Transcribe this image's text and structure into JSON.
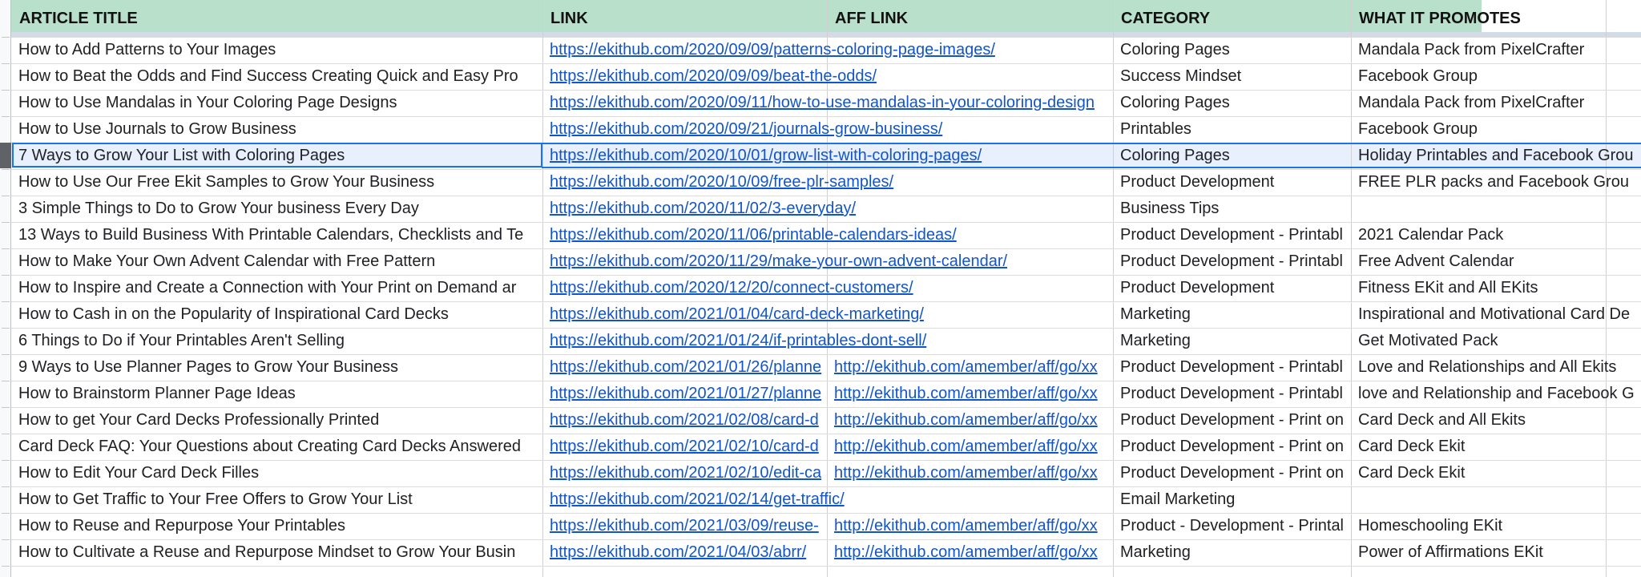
{
  "columns": [
    {
      "key": "title",
      "label": "ARTICLE TITLE"
    },
    {
      "key": "link",
      "label": "LINK"
    },
    {
      "key": "aff",
      "label": "AFF LINK"
    },
    {
      "key": "category",
      "label": "CATEGORY"
    },
    {
      "key": "promotes",
      "label": "WHAT IT PROMOTES"
    }
  ],
  "rows": [
    {
      "title": "How to Add Patterns to Your Images",
      "link": "https://ekithub.com/2020/09/09/patterns-coloring-page-images/",
      "aff": "",
      "category": "Coloring Pages",
      "promotes": "Mandala Pack from PixelCrafter"
    },
    {
      "title": "How to Beat the Odds and Find Success Creating Quick and Easy Pro",
      "link": "https://ekithub.com/2020/09/09/beat-the-odds/",
      "aff": "",
      "category": "Success Mindset",
      "promotes": "Facebook Group"
    },
    {
      "title": "How to Use Mandalas in Your Coloring Page Designs",
      "link": "https://ekithub.com/2020/09/11/how-to-use-mandalas-in-your-coloring-design",
      "aff": "",
      "category": "Coloring Pages",
      "promotes": "Mandala Pack from PixelCrafter"
    },
    {
      "title": "How to Use Journals to Grow Business",
      "link": "https://ekithub.com/2020/09/21/journals-grow-business/",
      "aff": "",
      "category": "Printables",
      "promotes": "Facebook Group"
    },
    {
      "title": "7 Ways to Grow Your List with Coloring Pages",
      "link": "https://ekithub.com/2020/10/01/grow-list-with-coloring-pages/",
      "aff": "",
      "category": "Coloring Pages",
      "promotes": "Holiday Printables and Facebook Grou"
    },
    {
      "title": "How to Use Our Free Ekit Samples to Grow Your Business",
      "link": "https://ekithub.com/2020/10/09/free-plr-samples/",
      "aff": "",
      "category": "Product Development",
      "promotes": "FREE PLR packs and Facebook Grou"
    },
    {
      "title": "3 Simple Things to Do to Grow Your business Every Day",
      "link": "https://ekithub.com/2020/11/02/3-everyday/",
      "aff": "",
      "category": "Business Tips",
      "promotes": ""
    },
    {
      "title": "13 Ways to Build Business With Printable Calendars, Checklists and Te",
      "link": "https://ekithub.com/2020/11/06/printable-calendars-ideas/",
      "aff": "",
      "category": "Product Development - Printabl",
      "promotes": "2021 Calendar Pack"
    },
    {
      "title": "How to Make Your Own Advent Calendar with Free Pattern",
      "link": "https://ekithub.com/2020/11/29/make-your-own-advent-calendar/",
      "aff": "",
      "category": "Product Development - Printabl",
      "promotes": "Free Advent Calendar"
    },
    {
      "title": "How to Inspire and Create a Connection with Your Print on Demand ar",
      "link": "https://ekithub.com/2020/12/20/connect-customers/",
      "aff": "",
      "category": "Product Development",
      "promotes": "Fitness EKit and All EKits"
    },
    {
      "title": "How to Cash in on the Popularity of Inspirational Card Decks",
      "link": "https://ekithub.com/2021/01/04/card-deck-marketing/",
      "aff": "",
      "category": "Marketing",
      "promotes": "Inspirational and Motivational Card De"
    },
    {
      "title": "6 Things to Do if Your Printables Aren't Selling",
      "link": "https://ekithub.com/2021/01/24/if-printables-dont-sell/",
      "aff": "",
      "category": "Marketing",
      "promotes": "Get Motivated Pack"
    },
    {
      "title": "9 Ways to Use Planner Pages to Grow Your Business",
      "link": "https://ekithub.com/2021/01/26/planne",
      "aff": "http://ekithub.com/amember/aff/go/xx",
      "category": "Product Development - Printabl",
      "promotes": "Love and Relationships and All Ekits"
    },
    {
      "title": "How to Brainstorm Planner Page Ideas",
      "link": "https://ekithub.com/2021/01/27/planne",
      "aff": "http://ekithub.com/amember/aff/go/xx",
      "category": "Product Development - Printabl",
      "promotes": "love and Relationship and Facebook G"
    },
    {
      "title": "How to get Your Card Decks Professionally Printed",
      "link": "https://ekithub.com/2021/02/08/card-d",
      "aff": "http://ekithub.com/amember/aff/go/xx",
      "category": "Product Development - Print on",
      "promotes": "Card Deck and All Ekits"
    },
    {
      "title": "Card Deck FAQ: Your Questions about Creating Card Decks Answered",
      "link": "https://ekithub.com/2021/02/10/card-d",
      "aff": "http://ekithub.com/amember/aff/go/xx",
      "category": "Product Development - Print on",
      "promotes": "Card Deck Ekit"
    },
    {
      "title": "How to Edit Your Card Deck Filles",
      "link": "https://ekithub.com/2021/02/10/edit-ca",
      "aff": "http://ekithub.com/amember/aff/go/xx",
      "category": "Product Development - Print on",
      "promotes": "Card Deck Ekit"
    },
    {
      "title": "How to Get Traffic to Your Free Offers to Grow Your List",
      "link": "https://ekithub.com/2021/02/14/get-traffic/",
      "aff": "",
      "category": "Email Marketing",
      "promotes": ""
    },
    {
      "title": "How to Reuse and Repurpose Your Printables",
      "link": "https://ekithub.com/2021/03/09/reuse-",
      "aff": "http://ekithub.com/amember/aff/go/xx",
      "category": "Product - Development - Printal",
      "promotes": "Homeschooling EKit"
    },
    {
      "title": "How to Cultivate a Reuse and Repurpose Mindset to Grow Your Busin",
      "link": "https://ekithub.com/2021/04/03/abrr/",
      "aff": "http://ekithub.com/amember/aff/go/xx",
      "category": "Marketing",
      "promotes": "Power of Affirmations EKit"
    }
  ],
  "selected_row_index": 4,
  "colors": {
    "header_bg": "#b8e0cb",
    "link": "#1155cc",
    "selection_border": "#1a73e8",
    "selection_fill": "#e8f0fe"
  }
}
